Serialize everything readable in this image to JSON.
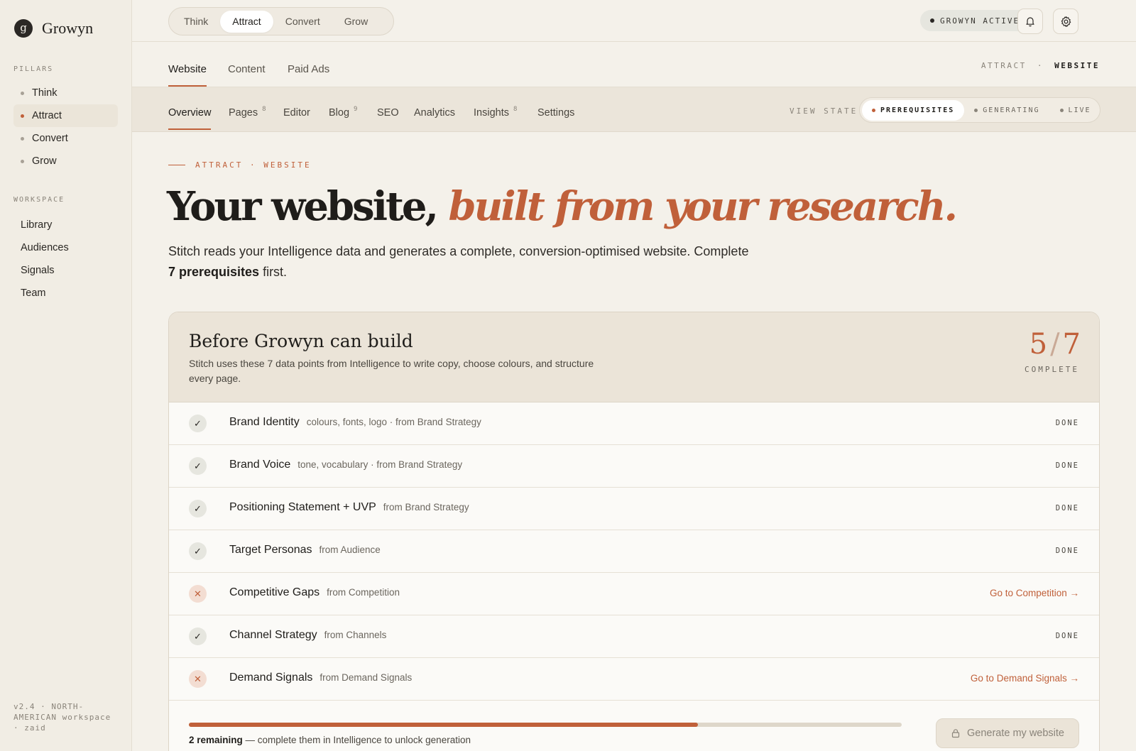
{
  "brand": {
    "mark": "g",
    "name": "Growyn"
  },
  "sidebar": {
    "pillars_label": "PILLARS",
    "pillars": [
      {
        "label": "Think",
        "active": false
      },
      {
        "label": "Attract",
        "active": true
      },
      {
        "label": "Convert",
        "active": false
      },
      {
        "label": "Grow",
        "active": false
      }
    ],
    "workspace_label": "WORKSPACE",
    "workspace": [
      "Library",
      "Audiences",
      "Signals",
      "Team"
    ],
    "footer": "v2.4 · NORTH-AMERICAN workspace · zaid"
  },
  "topbar": {
    "pills": [
      "Think",
      "Attract",
      "Convert",
      "Grow"
    ],
    "active_pill": "Attract",
    "status": "GROWYN ACTIVE",
    "icons": [
      "bell-icon",
      "gear-icon"
    ]
  },
  "subnav": {
    "tabs": [
      "Website",
      "Content",
      "Paid Ads"
    ],
    "active": "Website",
    "crumb_parent": "ATTRACT",
    "crumb_sep": "·",
    "crumb_current": "WEBSITE"
  },
  "thirdnav": {
    "tabs": [
      {
        "label": "Overview",
        "count": ""
      },
      {
        "label": "Pages",
        "count": "8"
      },
      {
        "label": "Editor",
        "count": ""
      },
      {
        "label": "Blog",
        "count": "9"
      },
      {
        "label": "SEO",
        "count": ""
      },
      {
        "label": "Analytics",
        "count": ""
      },
      {
        "label": "Insights",
        "count": "8"
      },
      {
        "label": "Settings",
        "count": ""
      }
    ],
    "view_state_label": "VIEW STATE",
    "view_states": [
      "PREREQUISITES",
      "GENERATING",
      "LIVE"
    ],
    "active_view_state": "PREREQUISITES"
  },
  "hero": {
    "eyebrow": "ATTRACT · WEBSITE",
    "title_plain": "Your website, ",
    "title_em": "built from your research.",
    "sub_before": "Stitch reads your Intelligence data and generates a complete, conversion-optimised website. Complete ",
    "sub_bold": "7 prerequisites",
    "sub_after": " first."
  },
  "card": {
    "title": "Before Growyn can build",
    "desc": "Stitch uses these 7 data points from Intelligence to write copy, choose colours, and structure every page.",
    "done_count": "5",
    "total_count": "7",
    "complete_label": "COMPLETE",
    "items": [
      {
        "name": "Brand Identity",
        "source": "colours, fonts, logo · from Brand Strategy",
        "done": true,
        "state": "DONE"
      },
      {
        "name": "Brand Voice",
        "source": "tone, vocabulary · from Brand Strategy",
        "done": true,
        "state": "DONE"
      },
      {
        "name": "Positioning Statement + UVP",
        "source": "from Brand Strategy",
        "done": true,
        "state": "DONE"
      },
      {
        "name": "Target Personas",
        "source": "from Audience",
        "done": true,
        "state": "DONE"
      },
      {
        "name": "Competitive Gaps",
        "source": "from Competition",
        "done": false,
        "action": "Go to Competition →"
      },
      {
        "name": "Channel Strategy",
        "source": "from Channels",
        "done": true,
        "state": "DONE"
      },
      {
        "name": "Demand Signals",
        "source": "from Demand Signals",
        "done": false,
        "action": "Go to Demand Signals →"
      }
    ],
    "progress": 0.714,
    "remaining_bold": "2 remaining",
    "remaining_text": " — complete them in Intelligence to unlock generation",
    "generate_label": "Generate my website"
  },
  "colors": {
    "accent": "#c0603a",
    "background": "#f4f1ea",
    "ink": "#1f1d1a"
  }
}
